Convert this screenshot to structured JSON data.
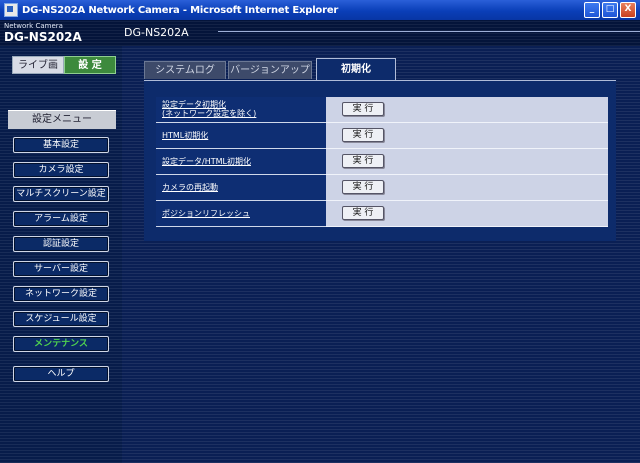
{
  "window": {
    "title": "DG-NS202A Network Camera - Microsoft Internet Explorer",
    "buttons": {
      "minimize": "_",
      "maximize": "□",
      "close": "X"
    }
  },
  "header": {
    "brand_small": "Network Camera",
    "brand_model": "DG-NS202A",
    "model_title": "DG-NS202A"
  },
  "mode": {
    "live": "ライブ画",
    "setup": "設 定"
  },
  "sidebar": {
    "menu_heading": "設定メニュー",
    "items": [
      {
        "label": "基本設定"
      },
      {
        "label": "カメラ設定"
      },
      {
        "label": "マルチスクリーン設定"
      },
      {
        "label": "アラーム設定"
      },
      {
        "label": "認証設定"
      },
      {
        "label": "サーバー設定"
      },
      {
        "label": "ネットワーク設定"
      },
      {
        "label": "スケジュール設定"
      },
      {
        "label": "メンテナンス"
      },
      {
        "label": "ヘルプ"
      }
    ]
  },
  "tabs": [
    {
      "label": "システムログ"
    },
    {
      "label": "バージョンアップ"
    },
    {
      "label": "初期化"
    }
  ],
  "rows": [
    {
      "label_line1": "設定データ初期化",
      "label_line2": "(ネットワーク設定を除く)",
      "button": "実 行"
    },
    {
      "label": "HTML初期化",
      "button": "実 行"
    },
    {
      "label": "設定データ/HTML初期化",
      "button": "実 行"
    },
    {
      "label": "カメラの再起動",
      "button": "実 行"
    },
    {
      "label": "ポジションリフレッシュ",
      "button": "実 行"
    }
  ],
  "colors": {
    "active_menu": "#4fd24f",
    "setup_button": "#3d8a3d",
    "panel_background": "#0d2b6b"
  }
}
